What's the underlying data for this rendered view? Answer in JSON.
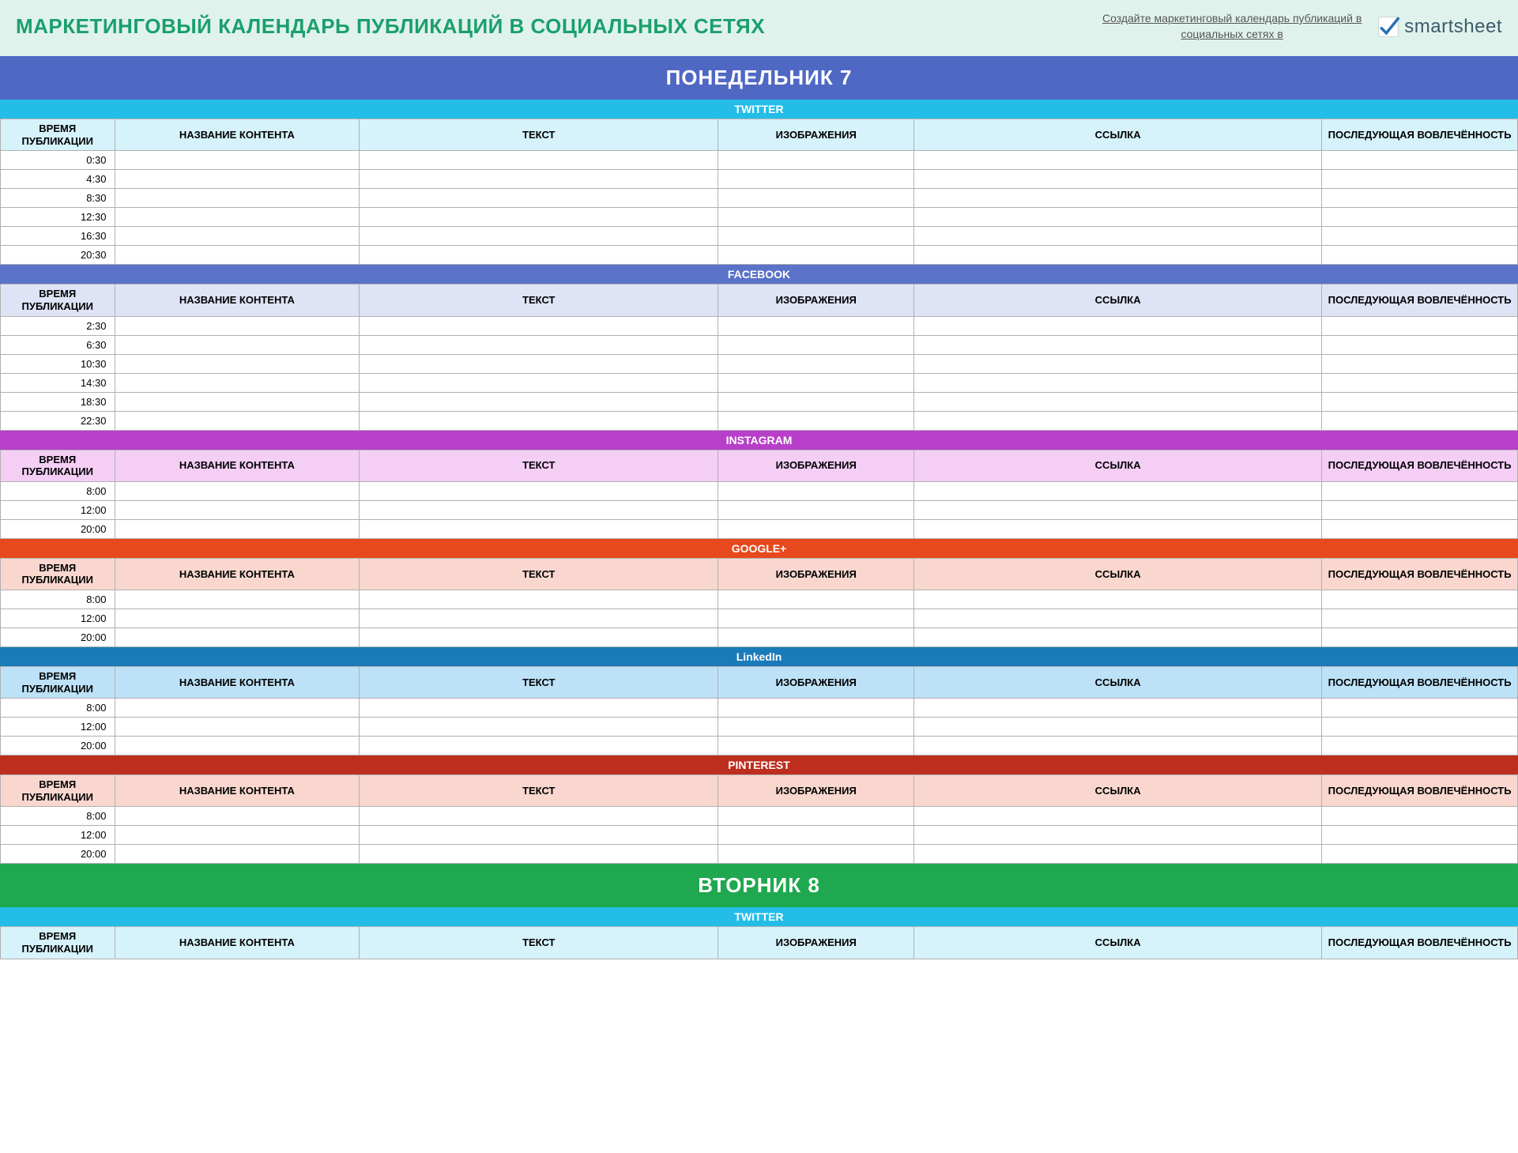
{
  "header": {
    "title": "МАРКЕТИНГОВЫЙ КАЛЕНДАРЬ ПУБЛИКАЦИЙ В СОЦИАЛЬНЫХ СЕТЯХ",
    "link_text": "Создайте маркетинговый календарь публикаций в\nсоциальных сетях в",
    "logo_text": "smartsheet"
  },
  "columns": {
    "time": "ВРЕМЯ ПУБЛИКАЦИИ",
    "name": "НАЗВАНИЕ КОНТЕНТА",
    "text": "ТЕКСТ",
    "image": "ИЗОБРАЖЕНИЯ",
    "link": "ССЫЛКА",
    "engagement": "ПОСЛЕДУЮЩАЯ ВОВЛЕЧЁННОСТЬ"
  },
  "days": [
    {
      "label": "ПОНЕДЕЛЬНИК   7",
      "class": "day-monday",
      "networks": [
        {
          "name": "TWITTER",
          "head_class": "twitter-head",
          "th_class": "twitter-th",
          "times": [
            "0:30",
            "4:30",
            "8:30",
            "12:30",
            "16:30",
            "20:30"
          ]
        },
        {
          "name": "FACEBOOK",
          "head_class": "facebook-head",
          "th_class": "facebook-th",
          "times": [
            "2:30",
            "6:30",
            "10:30",
            "14:30",
            "18:30",
            "22:30"
          ]
        },
        {
          "name": "INSTAGRAM",
          "head_class": "instagram-head",
          "th_class": "instagram-th",
          "times": [
            "8:00",
            "12:00",
            "20:00"
          ]
        },
        {
          "name": "GOOGLE+",
          "head_class": "google-head",
          "th_class": "google-th",
          "times": [
            "8:00",
            "12:00",
            "20:00"
          ]
        },
        {
          "name": "LinkedIn",
          "head_class": "linkedin-head",
          "th_class": "linkedin-th",
          "times": [
            "8:00",
            "12:00",
            "20:00"
          ]
        },
        {
          "name": "PINTEREST",
          "head_class": "pinterest-head",
          "th_class": "pinterest-th",
          "times": [
            "8:00",
            "12:00",
            "20:00"
          ]
        }
      ]
    },
    {
      "label": "ВТОРНИК   8",
      "class": "day-tuesday",
      "networks": [
        {
          "name": "TWITTER",
          "head_class": "twitter-head",
          "th_class": "twitter-th",
          "times": []
        }
      ]
    }
  ]
}
